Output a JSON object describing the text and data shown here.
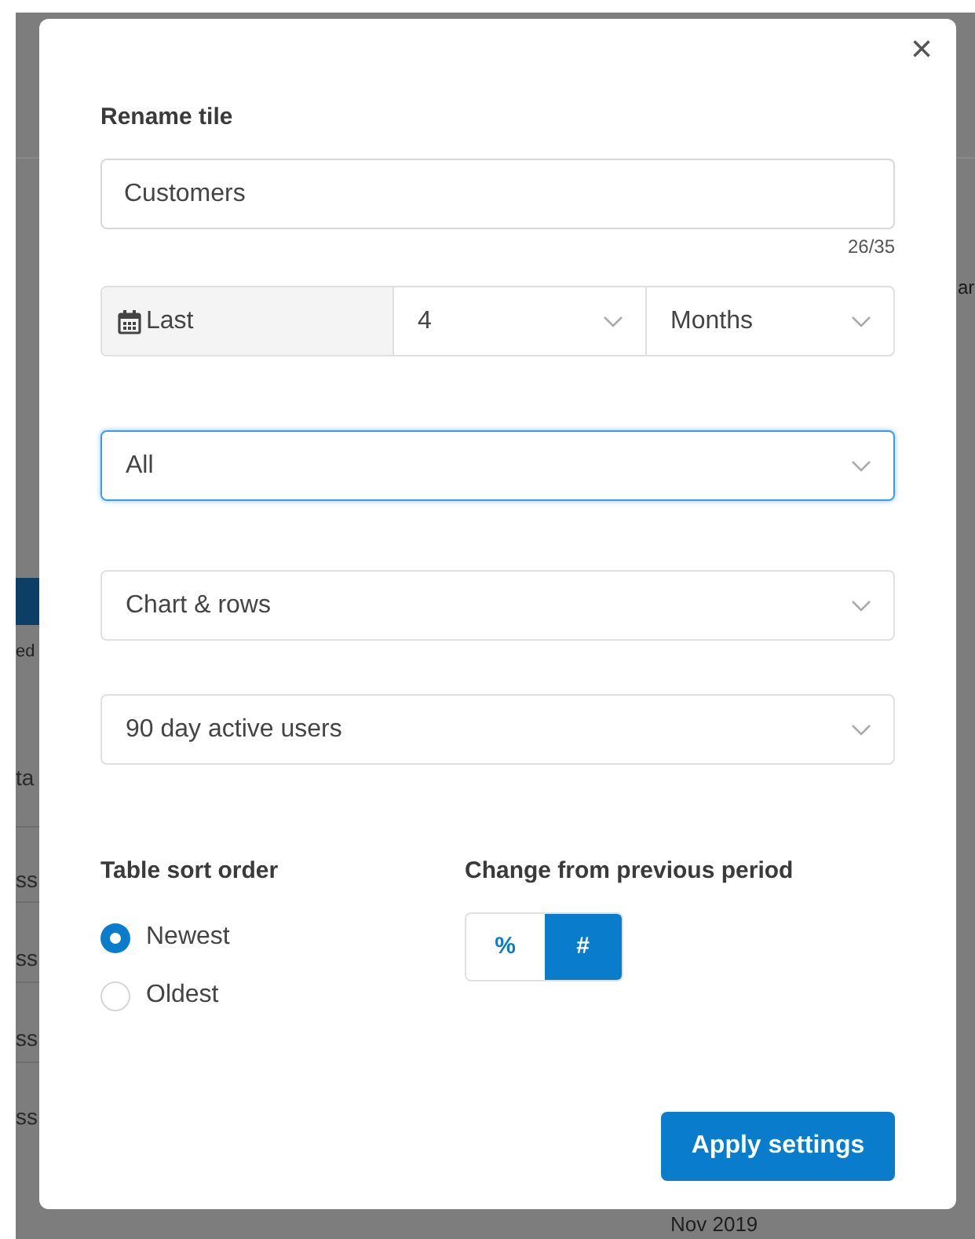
{
  "background": {
    "fragments": [
      "ar",
      "ed",
      "ta",
      "ss",
      "ss",
      "ss",
      "ss"
    ],
    "date": "Nov 2019"
  },
  "dialog": {
    "close": "×",
    "rename": {
      "label": "Rename tile",
      "value": "Customers",
      "counter": "26/35"
    },
    "period": {
      "prefix": "Last",
      "amount": "4",
      "unit": "Months"
    },
    "selects": [
      {
        "value": "All",
        "focused": true
      },
      {
        "value": "Chart & rows",
        "focused": false
      },
      {
        "value": "90 day active users",
        "focused": false
      }
    ],
    "sort": {
      "heading": "Table sort order",
      "options": [
        {
          "label": "Newest",
          "selected": true
        },
        {
          "label": "Oldest",
          "selected": false
        }
      ]
    },
    "change": {
      "heading": "Change from previous period",
      "options": [
        {
          "label": "%",
          "selected": false
        },
        {
          "label": "#",
          "selected": true
        }
      ]
    },
    "apply": "Apply settings"
  }
}
